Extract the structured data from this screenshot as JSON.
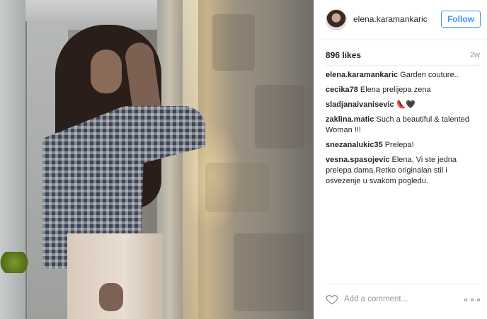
{
  "post": {
    "image_icon": "photo-woman-gingham-shirt",
    "author": "elena.karamankaric",
    "follow_label": "Follow",
    "likes": "896 likes",
    "age": "2w"
  },
  "comments": [
    {
      "author": "elena.karamankaric",
      "text": "Garden couture.."
    },
    {
      "author": "cecika78",
      "text": "Elena prelijepa zena"
    },
    {
      "author": "sladjanaivanisevic",
      "text": "👠🖤"
    },
    {
      "author": "zaklina.matic",
      "text": "Such a beautiful & talented Woman !!!"
    },
    {
      "author": "snezanalukic35",
      "text": "Prelepa!"
    },
    {
      "author": "vesna.spasojevic",
      "text": "Elena, Vi ste jedna prelepa dama.Retko originalan stil i osvezenje u svakom pogledu."
    }
  ],
  "footer": {
    "comment_placeholder": "Add a comment...",
    "heart_icon": "heart-outline-icon",
    "more_icon": "ellipsis-icon"
  },
  "colors": {
    "accent": "#3897f0",
    "muted": "#999999",
    "text": "#262626"
  }
}
